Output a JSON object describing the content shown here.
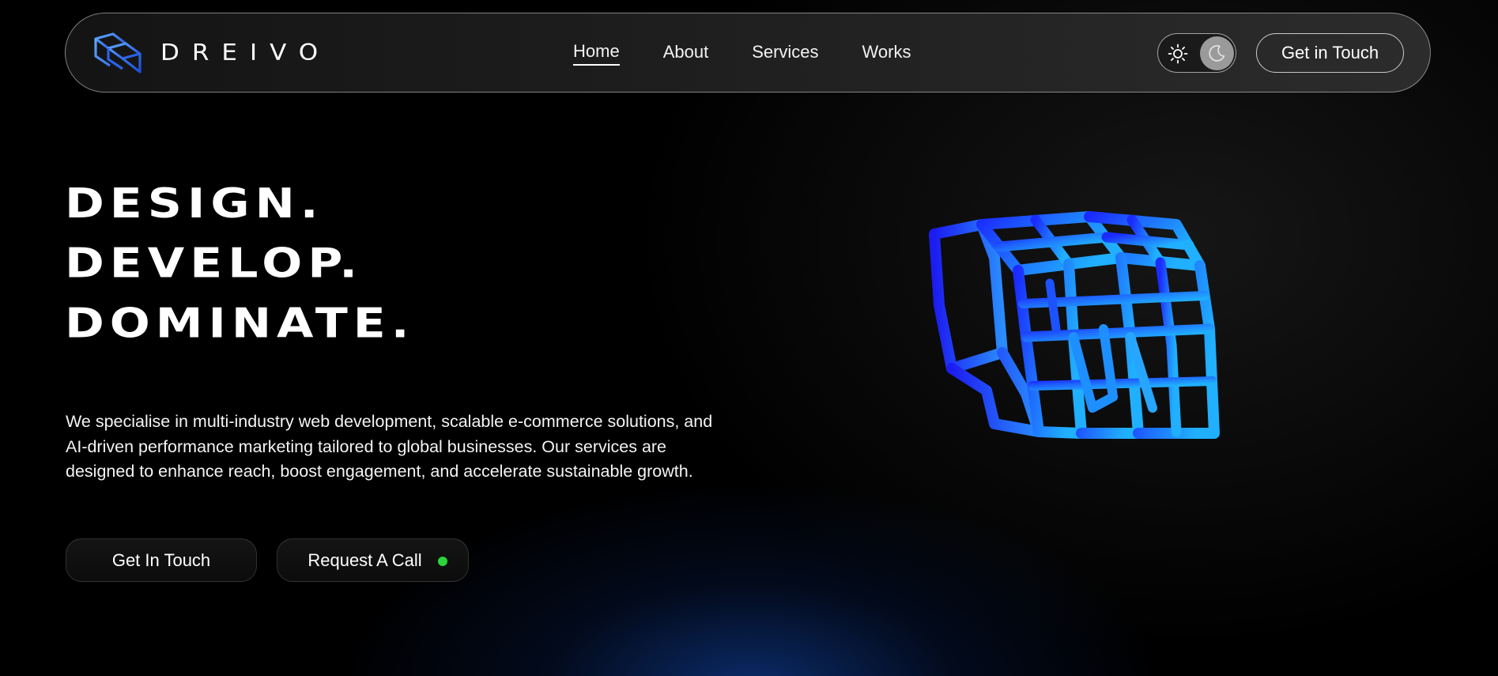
{
  "brand": {
    "name": "DREIVO",
    "logo_icon": "dreivo-logo-mark"
  },
  "nav": {
    "links": [
      "Home",
      "About",
      "Services",
      "Works"
    ],
    "active": "Home",
    "cta_label": "Get in Touch"
  },
  "theme_toggle": {
    "options": [
      "light",
      "dark"
    ],
    "selected": "dark",
    "icons": [
      "sun-icon",
      "moon-icon"
    ]
  },
  "hero": {
    "headline": [
      "DESIGN.",
      "DEVELOP.",
      "DOMINATE."
    ],
    "description": "We specialise in multi-industry web development, scalable e-commerce solutions, and AI-driven performance marketing tailored to global businesses. Our services are designed to enhance reach, boost engagement, and accelerate sustainable growth.",
    "buttons": {
      "primary_label": "Get In Touch",
      "secondary_label": "Request A Call"
    },
    "art": "blue-3d-lattice-cube"
  },
  "colors": {
    "background": "#000000",
    "accent_blue": "#1e5bff",
    "accent_cyan": "#1fa8ff",
    "status_green": "#2bd43b",
    "toggle_knob": "#9a9a9a"
  }
}
